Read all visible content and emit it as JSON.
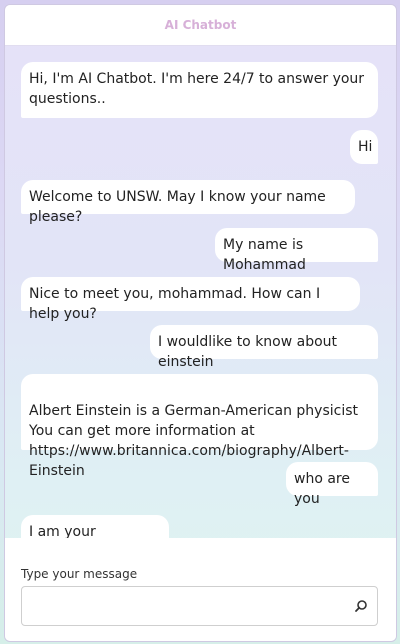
{
  "header": {
    "title": "AI Chatbot"
  },
  "messages": [
    {
      "sender": "bot",
      "text": "Hi, I'm AI Chatbot. I'm here 24/7 to answer your questions.."
    },
    {
      "sender": "user",
      "text": "Hi"
    },
    {
      "sender": "bot",
      "text": "Welcome to UNSW. May I know your name please?"
    },
    {
      "sender": "user",
      "text": "My name is Mohammad"
    },
    {
      "sender": "bot",
      "text": "Nice to meet you, mohammad. How can I help you?"
    },
    {
      "sender": "user",
      "text": "I wouldlike to know about einstein"
    },
    {
      "sender": "bot",
      "text": "Albert Einstein is a German-American physicist\nYou can get more information at\nhttps://www.britannica.com/biography/Albert-Einstein"
    },
    {
      "sender": "user",
      "text": "who are you"
    },
    {
      "sender": "bot",
      "text": "I am your assistance!"
    }
  ],
  "composer": {
    "label": "Type your message",
    "value": "",
    "placeholder": "",
    "send_icon": "search-icon"
  }
}
